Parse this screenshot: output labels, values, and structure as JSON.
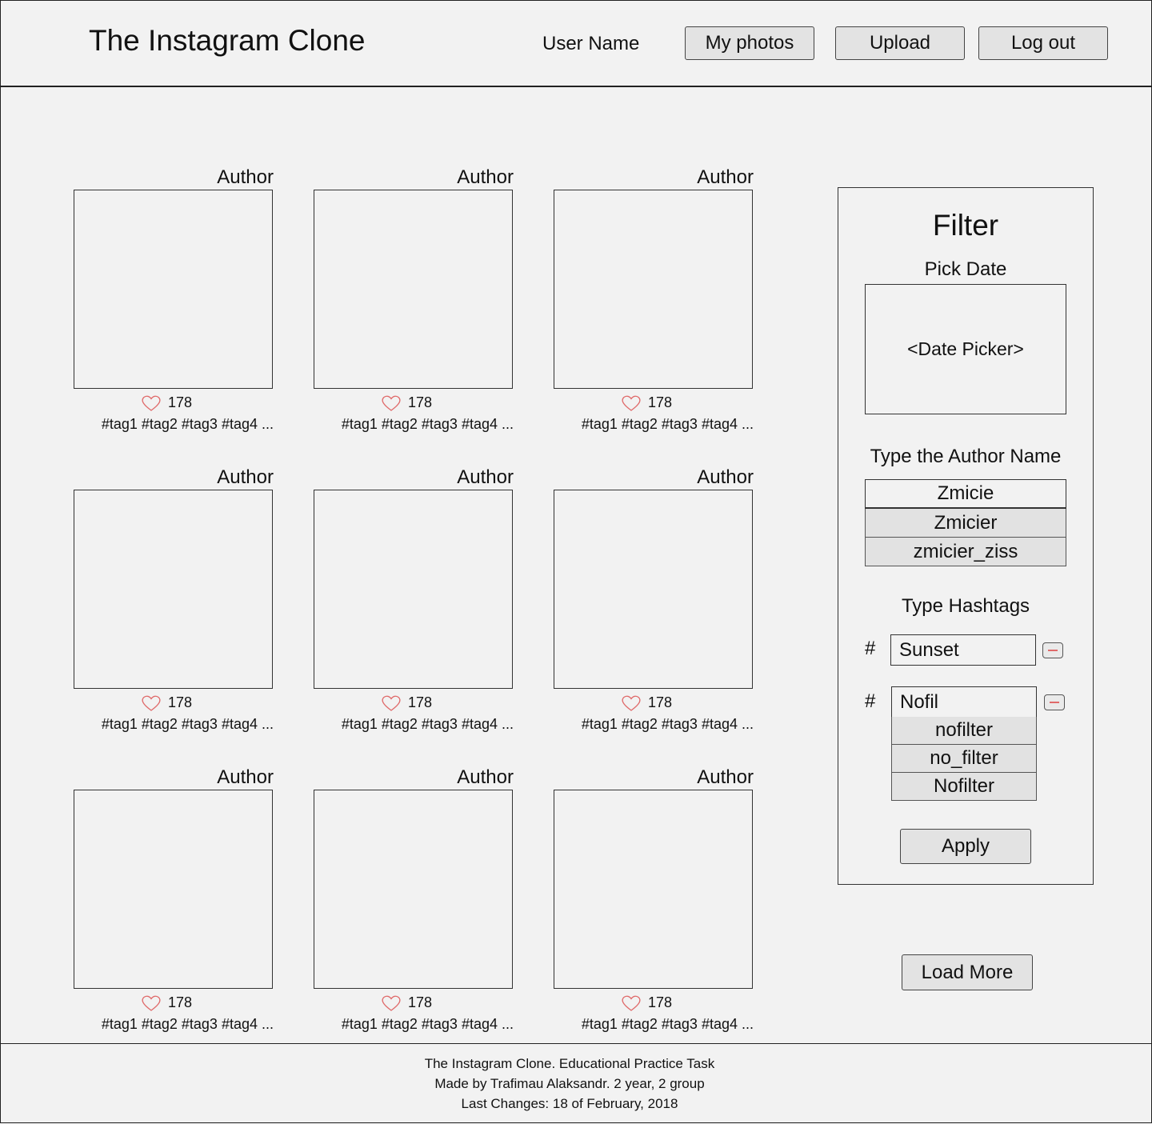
{
  "header": {
    "title": "The Instagram Clone",
    "user_name": "User Name",
    "buttons": {
      "my_photos": "My photos",
      "upload": "Upload",
      "logout": "Log out"
    }
  },
  "gallery": {
    "cards": [
      {
        "author": "Author",
        "likes": "178",
        "tags": "#tag1 #tag2 #tag3 #tag4 ..."
      },
      {
        "author": "Author",
        "likes": "178",
        "tags": "#tag1 #tag2 #tag3 #tag4 ..."
      },
      {
        "author": "Author",
        "likes": "178",
        "tags": "#tag1 #tag2 #tag3 #tag4 ..."
      },
      {
        "author": "Author",
        "likes": "178",
        "tags": "#tag1 #tag2 #tag3 #tag4 ..."
      },
      {
        "author": "Author",
        "likes": "178",
        "tags": "#tag1 #tag2 #tag3 #tag4 ..."
      },
      {
        "author": "Author",
        "likes": "178",
        "tags": "#tag1 #tag2 #tag3 #tag4 ..."
      },
      {
        "author": "Author",
        "likes": "178",
        "tags": "#tag1 #tag2 #tag3 #tag4 ..."
      },
      {
        "author": "Author",
        "likes": "178",
        "tags": "#tag1 #tag2 #tag3 #tag4 ..."
      },
      {
        "author": "Author",
        "likes": "178",
        "tags": "#tag1 #tag2 #tag3 #tag4 ..."
      }
    ],
    "like_icon": "heart-icon",
    "like_color": "#e06a6a",
    "load_more": "Load More"
  },
  "filter": {
    "title": "Filter",
    "date_label": "Pick Date",
    "date_picker": "<Date Picker>",
    "author_label": "Type the Author Name",
    "author_value": "Zmicie",
    "author_suggestions": [
      "Zmicier",
      "zmicier_ziss"
    ],
    "hashtags_label": "Type Hashtags",
    "hash_symbol": "#",
    "hashtag_1": "Sunset",
    "hashtag_2": "Nofil",
    "hashtag_suggestions": [
      "nofilter",
      "no_filter",
      "Nofilter"
    ],
    "apply": "Apply"
  },
  "footer": {
    "line1": "The Instagram Clone. Educational Practice Task",
    "line2": "Made by Trafimau Alaksandr. 2 year, 2 group",
    "line3": "Last Changes: 18 of February, 2018"
  }
}
